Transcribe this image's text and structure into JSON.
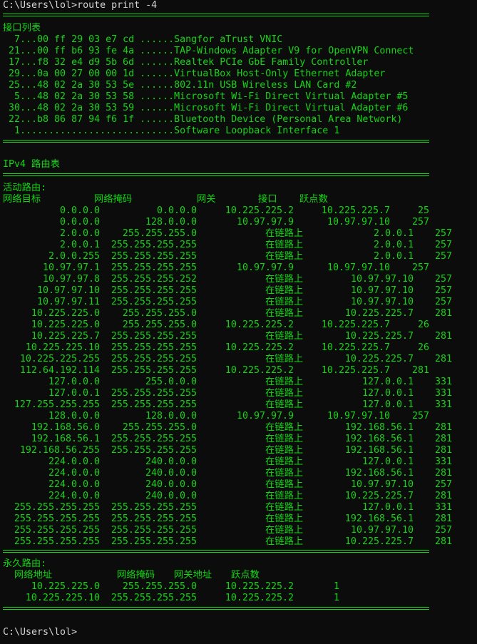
{
  "prompt_command": "C:\\Users\\lol>route print -4",
  "interface_list": {
    "title": "接口列表",
    "rows": [
      "  7...00 ff 29 03 e7 cd ......Sangfor aTrust VNIC",
      " 21...00 ff b6 93 fe 4a ......TAP-Windows Adapter V9 for OpenVPN Connect",
      " 17...f8 32 e4 d9 5b 6d ......Realtek PCIe GbE Family Controller",
      " 29...0a 00 27 00 00 1d ......VirtualBox Host-Only Ethernet Adapter",
      " 25...48 02 2a 30 53 5e ......802.11n USB Wireless LAN Card #2",
      "  5...48 02 2a 30 53 58 ......Microsoft Wi-Fi Direct Virtual Adapter #5",
      " 30...48 02 2a 30 53 59 ......Microsoft Wi-Fi Direct Virtual Adapter #6",
      " 22...b8 86 87 94 f6 1f ......Bluetooth Device (Personal Area Network)",
      "  1...........................Software Loopback Interface 1"
    ]
  },
  "ipv4_title": "IPv4 路由表",
  "active_routes": {
    "title": "活动路由:",
    "headers": [
      "网络目标",
      "网络掩码",
      "网关",
      "接口",
      "跃点数"
    ],
    "rows": [
      [
        "0.0.0.0",
        "0.0.0.0",
        "10.225.225.2",
        "10.225.225.7",
        "25"
      ],
      [
        "0.0.0.0",
        "128.0.0.0",
        "10.97.97.9",
        "10.97.97.10",
        "257"
      ],
      [
        "2.0.0.0",
        "255.255.255.0",
        "在链路上",
        "2.0.0.1",
        "257"
      ],
      [
        "2.0.0.1",
        "255.255.255.255",
        "在链路上",
        "2.0.0.1",
        "257"
      ],
      [
        "2.0.0.255",
        "255.255.255.255",
        "在链路上",
        "2.0.0.1",
        "257"
      ],
      [
        "10.97.97.1",
        "255.255.255.255",
        "10.97.97.9",
        "10.97.97.10",
        "257"
      ],
      [
        "10.97.97.8",
        "255.255.255.252",
        "在链路上",
        "10.97.97.10",
        "257"
      ],
      [
        "10.97.97.10",
        "255.255.255.255",
        "在链路上",
        "10.97.97.10",
        "257"
      ],
      [
        "10.97.97.11",
        "255.255.255.255",
        "在链路上",
        "10.97.97.10",
        "257"
      ],
      [
        "10.225.225.0",
        "255.255.255.0",
        "在链路上",
        "10.225.225.7",
        "281"
      ],
      [
        "10.225.225.0",
        "255.255.255.0",
        "10.225.225.2",
        "10.225.225.7",
        "26"
      ],
      [
        "10.225.225.7",
        "255.255.255.255",
        "在链路上",
        "10.225.225.7",
        "281"
      ],
      [
        "10.225.225.10",
        "255.255.255.255",
        "10.225.225.2",
        "10.225.225.7",
        "26"
      ],
      [
        "10.225.225.255",
        "255.255.255.255",
        "在链路上",
        "10.225.225.7",
        "281"
      ],
      [
        "112.64.192.114",
        "255.255.255.255",
        "10.225.225.2",
        "10.225.225.7",
        "281"
      ],
      [
        "127.0.0.0",
        "255.0.0.0",
        "在链路上",
        "127.0.0.1",
        "331"
      ],
      [
        "127.0.0.1",
        "255.255.255.255",
        "在链路上",
        "127.0.0.1",
        "331"
      ],
      [
        "127.255.255.255",
        "255.255.255.255",
        "在链路上",
        "127.0.0.1",
        "331"
      ],
      [
        "128.0.0.0",
        "128.0.0.0",
        "10.97.97.9",
        "10.97.97.10",
        "257"
      ],
      [
        "192.168.56.0",
        "255.255.255.0",
        "在链路上",
        "192.168.56.1",
        "281"
      ],
      [
        "192.168.56.1",
        "255.255.255.255",
        "在链路上",
        "192.168.56.1",
        "281"
      ],
      [
        "192.168.56.255",
        "255.255.255.255",
        "在链路上",
        "192.168.56.1",
        "281"
      ],
      [
        "224.0.0.0",
        "240.0.0.0",
        "在链路上",
        "127.0.0.1",
        "331"
      ],
      [
        "224.0.0.0",
        "240.0.0.0",
        "在链路上",
        "192.168.56.1",
        "281"
      ],
      [
        "224.0.0.0",
        "240.0.0.0",
        "在链路上",
        "10.97.97.10",
        "257"
      ],
      [
        "224.0.0.0",
        "240.0.0.0",
        "在链路上",
        "10.225.225.7",
        "281"
      ],
      [
        "255.255.255.255",
        "255.255.255.255",
        "在链路上",
        "127.0.0.1",
        "331"
      ],
      [
        "255.255.255.255",
        "255.255.255.255",
        "在链路上",
        "192.168.56.1",
        "281"
      ],
      [
        "255.255.255.255",
        "255.255.255.255",
        "在链路上",
        "10.97.97.10",
        "257"
      ],
      [
        "255.255.255.255",
        "255.255.255.255",
        "在链路上",
        "10.225.225.7",
        "281"
      ]
    ]
  },
  "persistent_routes": {
    "title": "永久路由:",
    "headers": [
      "网络地址",
      "网络掩码",
      "网关地址",
      "跃点数"
    ],
    "rows": [
      [
        "10.225.225.0",
        "255.255.255.0",
        "10.225.225.2",
        "1"
      ],
      [
        "10.225.225.10",
        "255.255.255.255",
        "10.225.225.2",
        "1"
      ]
    ]
  },
  "final_prompt": "C:\\Users\\lol>"
}
